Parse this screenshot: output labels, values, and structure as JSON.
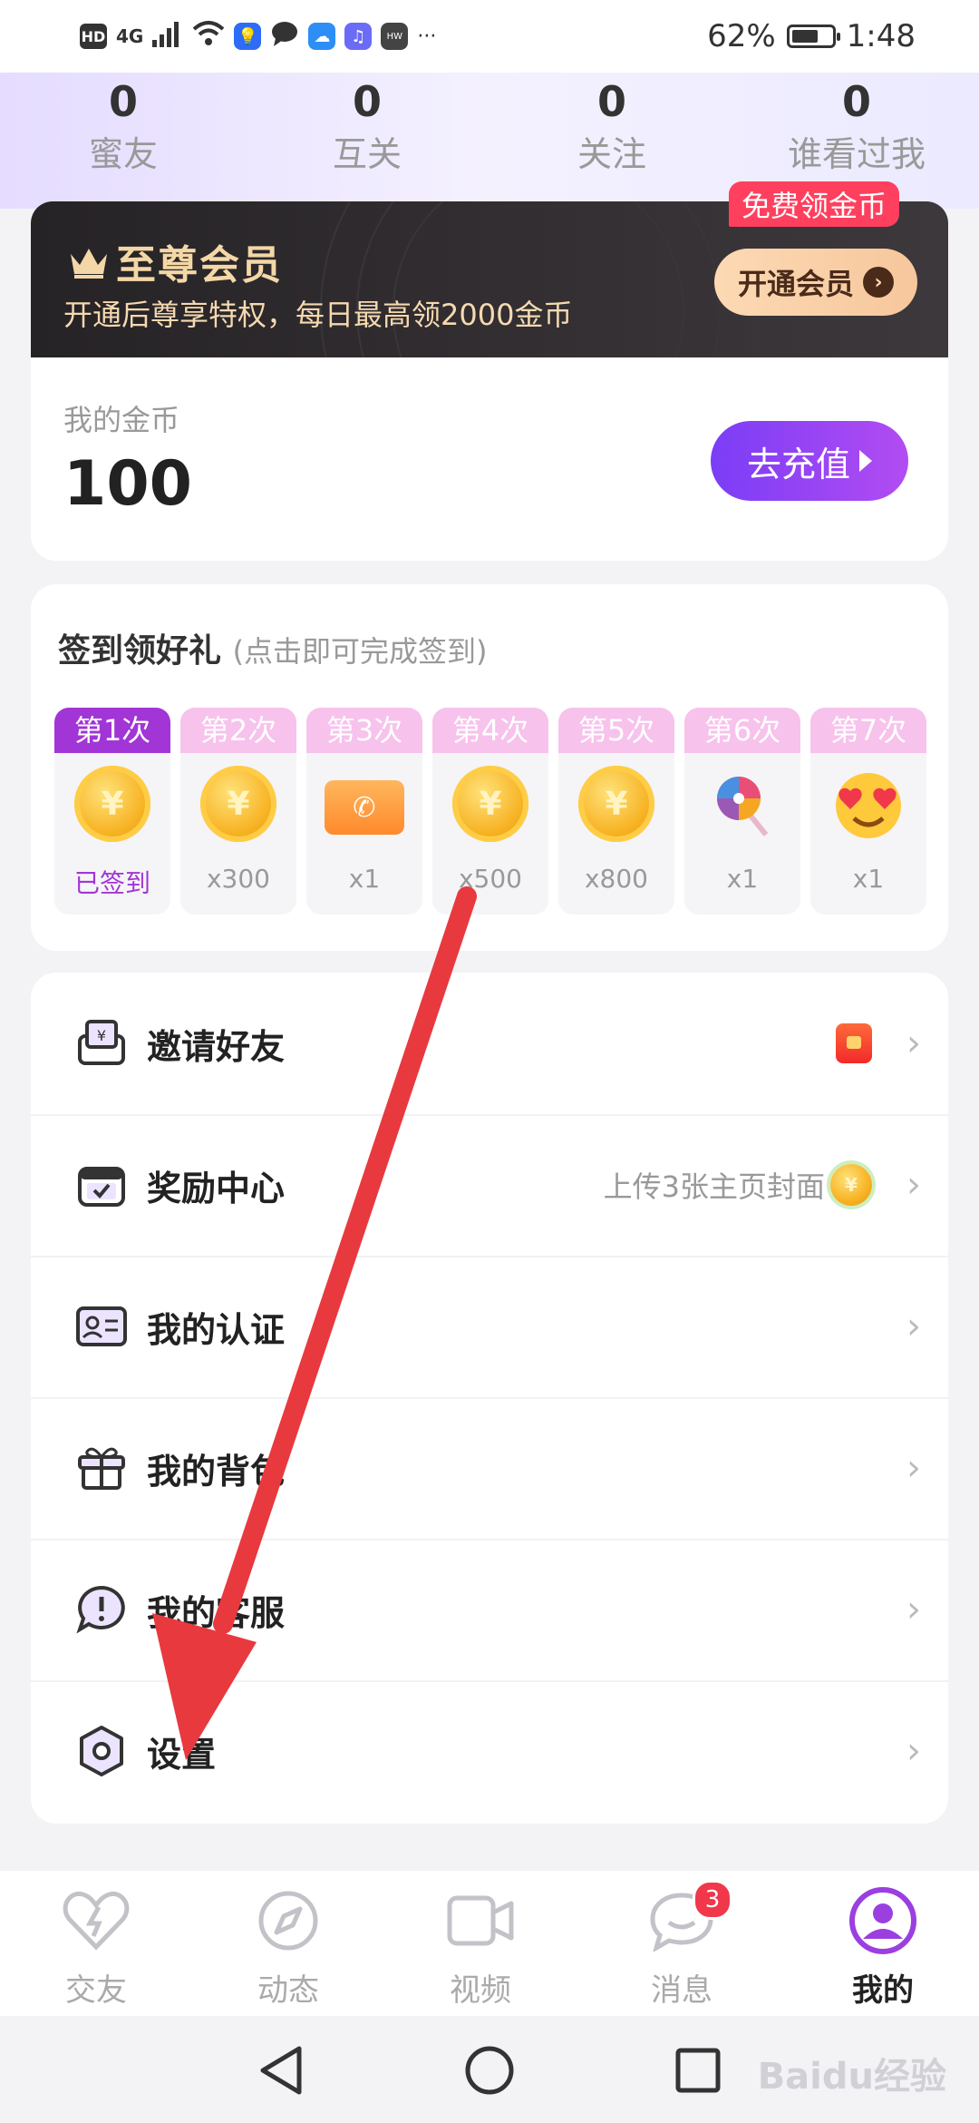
{
  "status": {
    "battery": "62%",
    "time": "1:48",
    "network": "4G",
    "hd": "HD"
  },
  "stats": [
    {
      "value": "0",
      "label": "蜜友"
    },
    {
      "value": "0",
      "label": "互关"
    },
    {
      "value": "0",
      "label": "关注"
    },
    {
      "value": "0",
      "label": "谁看过我"
    }
  ],
  "vip": {
    "title": "至尊会员",
    "subtitle": "开通后尊享特权，每日最高领2000金币",
    "button": "开通会员",
    "badge": "免费领金币"
  },
  "coins": {
    "label": "我的金币",
    "value": "100",
    "button": "去充值"
  },
  "checkin": {
    "title": "签到领好礼",
    "hint": "(点击即可完成签到)",
    "days": [
      {
        "header": "第1次",
        "reward": "已签到",
        "icon": "coin-icon"
      },
      {
        "header": "第2次",
        "reward": "x300",
        "icon": "coin-icon"
      },
      {
        "header": "第3次",
        "reward": "x1",
        "icon": "call-ticket-icon"
      },
      {
        "header": "第4次",
        "reward": "x500",
        "icon": "coin-icon"
      },
      {
        "header": "第5次",
        "reward": "x800",
        "icon": "coin-icon"
      },
      {
        "header": "第6次",
        "reward": "x1",
        "icon": "lollipop-icon"
      },
      {
        "header": "第7次",
        "reward": "x1",
        "icon": "heart-eyes-emoji-icon"
      }
    ]
  },
  "menu": [
    {
      "label": "邀请好友",
      "icon": "invite-wallet-icon",
      "right": ""
    },
    {
      "label": "奖励中心",
      "icon": "reward-calendar-icon",
      "right": "上传3张主页封面"
    },
    {
      "label": "我的认证",
      "icon": "id-card-icon",
      "right": ""
    },
    {
      "label": "我的背包",
      "icon": "gift-box-icon",
      "right": ""
    },
    {
      "label": "我的客服",
      "icon": "service-chat-icon",
      "right": ""
    },
    {
      "label": "设置",
      "icon": "gear-icon",
      "right": ""
    }
  ],
  "nav": [
    {
      "label": "交友",
      "icon": "heart-icon"
    },
    {
      "label": "动态",
      "icon": "compass-icon"
    },
    {
      "label": "视频",
      "icon": "video-icon"
    },
    {
      "label": "消息",
      "icon": "message-icon",
      "badge": "3"
    },
    {
      "label": "我的",
      "icon": "profile-icon"
    }
  ],
  "watermark": "Baidu经验",
  "colors": {
    "accent": "#a235d6",
    "annotation_arrow": "#e8393f",
    "vip_gold": "#f3d7a6"
  }
}
